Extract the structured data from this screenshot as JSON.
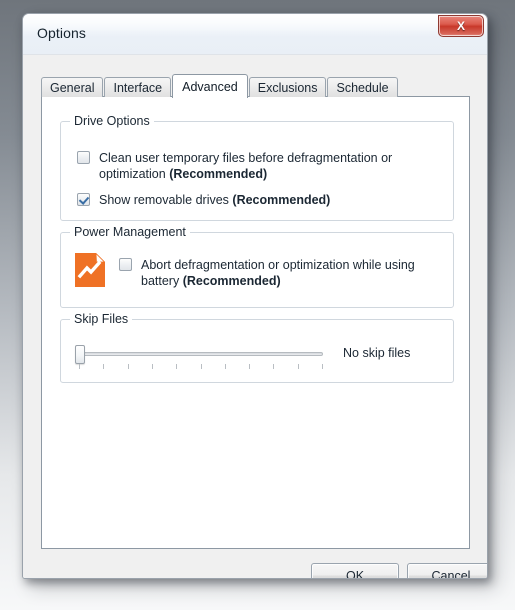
{
  "window": {
    "title": "Options",
    "close_icon": "close-x-icon",
    "close_label": "X"
  },
  "tabs": [
    {
      "label": "General",
      "selected": false
    },
    {
      "label": "Interface",
      "selected": false
    },
    {
      "label": "Advanced",
      "selected": true
    },
    {
      "label": "Exclusions",
      "selected": false
    },
    {
      "label": "Schedule",
      "selected": false
    }
  ],
  "groups": {
    "drive_options": {
      "title": "Drive Options",
      "options": [
        {
          "text": "Clean user temporary files before defragmentation or optimization ",
          "emphasis": "(Recommended)",
          "checked": false
        },
        {
          "text": "Show removable drives ",
          "emphasis": "(Recommended)",
          "checked": true
        }
      ]
    },
    "power_management": {
      "title": "Power Management",
      "icon": "battery-chart-document-icon",
      "icon_color": "#ef7125",
      "options": [
        {
          "text": "Abort defragmentation or optimization while using battery ",
          "emphasis": "(Recommended)",
          "checked": false
        }
      ]
    },
    "skip_files": {
      "title": "Skip Files",
      "slider": {
        "value": 0,
        "min": 0,
        "max": 10,
        "ticks": 11,
        "value_label": "No skip files"
      }
    }
  },
  "footer": {
    "ok_label": "OK",
    "cancel_label": "Cancel"
  }
}
